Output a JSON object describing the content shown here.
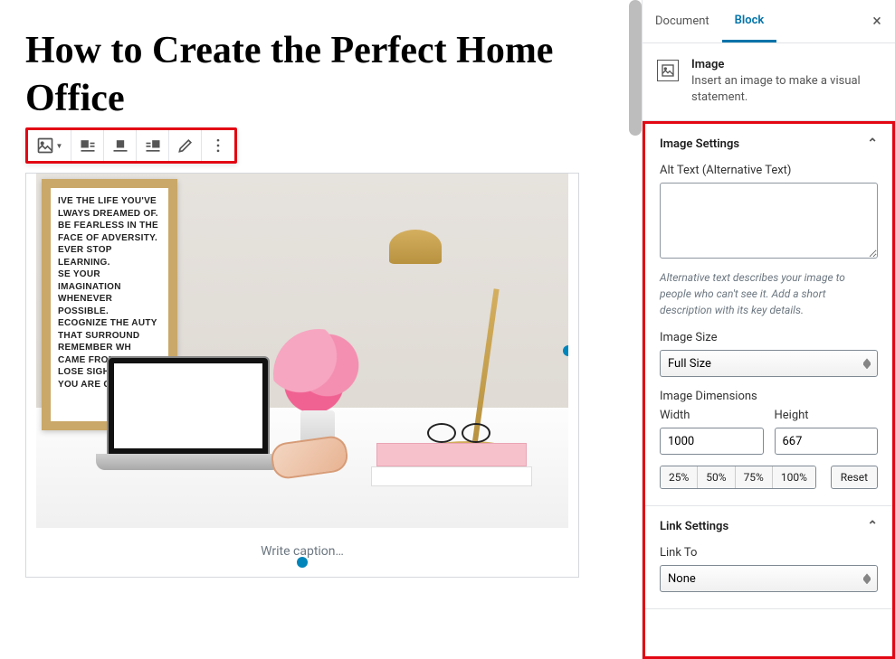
{
  "post": {
    "title": "How to Create the Perfect Home Office",
    "caption_placeholder": "Write caption…",
    "frame_text": "IVE THE LIFE YOU'VE\nLWAYS DREAMED OF.\nBE FEARLESS IN THE\nFACE OF ADVERSITY.\nEVER STOP LEARNING.\nSE YOUR IMAGINATION\nWHENEVER POSSIBLE.\nECOGNIZE THE    AUTY\nTHAT SURROUND\nREMEMBER WH\nCAME FROM, BU\nLOSE SIGHT OF\nYOU ARE GOI"
  },
  "sidebar": {
    "tabs": {
      "document": "Document",
      "block": "Block"
    },
    "block_info": {
      "name": "Image",
      "hint": "Insert an image to make a visual statement."
    },
    "image_settings": {
      "title": "Image Settings",
      "alt_label": "Alt Text (Alternative Text)",
      "alt_value": "",
      "alt_help": "Alternative text describes your image to people who can't see it. Add a short description with its key details.",
      "size_label": "Image Size",
      "size_value": "Full Size",
      "dim_label": "Image Dimensions",
      "width_label": "Width",
      "height_label": "Height",
      "width_value": "1000",
      "height_value": "667",
      "presets": [
        "25%",
        "50%",
        "75%",
        "100%"
      ],
      "reset": "Reset"
    },
    "link_settings": {
      "title": "Link Settings",
      "link_to_label": "Link To",
      "link_to_value": "None"
    }
  }
}
